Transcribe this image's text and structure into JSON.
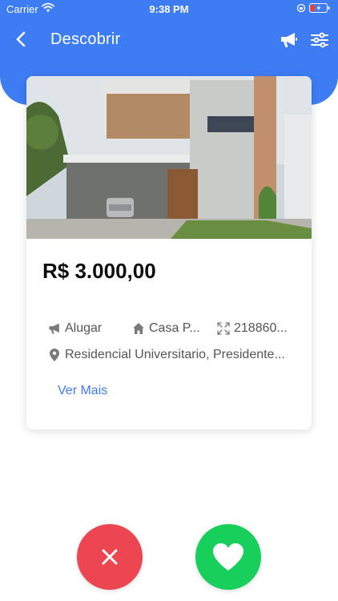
{
  "status_bar": {
    "carrier": "Carrier",
    "time": "9:38 PM"
  },
  "header": {
    "title": "Descobrir",
    "icons": [
      "chevron-left-icon",
      "megaphone-icon",
      "sliders-icon"
    ]
  },
  "listing": {
    "price": "R$ 3.000,00",
    "type": "Alugar",
    "category": "Casa P...",
    "area": "218860...",
    "location": "Residencial Universitario, Presidente...",
    "more_link": "Ver Mais"
  },
  "actions": {
    "dislike_icon": "close-icon",
    "like_icon": "heart-icon"
  },
  "colors": {
    "brand_blue": "#3e7cf4",
    "dislike_red": "#ec4651",
    "like_green": "#18cf5b"
  }
}
